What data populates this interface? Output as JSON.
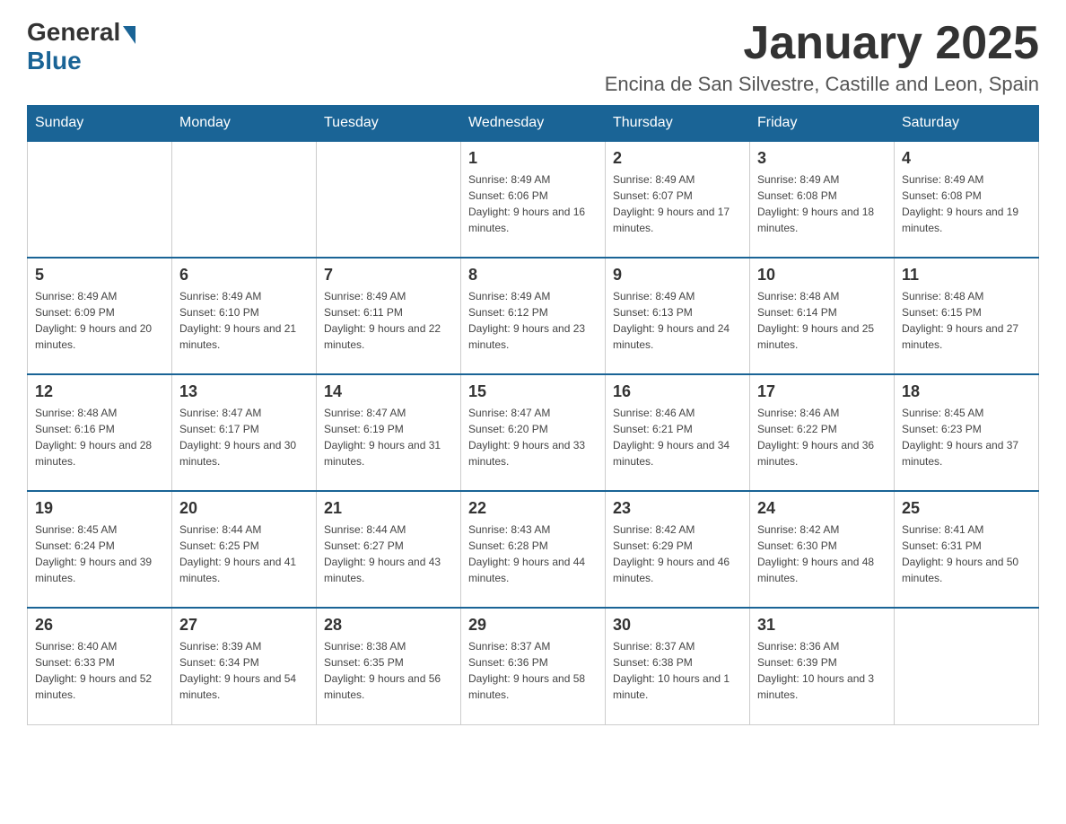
{
  "header": {
    "logo": {
      "general": "General",
      "blue": "Blue"
    },
    "title": "January 2025",
    "location": "Encina de San Silvestre, Castille and Leon, Spain"
  },
  "calendar": {
    "days_of_week": [
      "Sunday",
      "Monday",
      "Tuesday",
      "Wednesday",
      "Thursday",
      "Friday",
      "Saturday"
    ],
    "weeks": [
      [
        {
          "day": "",
          "info": ""
        },
        {
          "day": "",
          "info": ""
        },
        {
          "day": "",
          "info": ""
        },
        {
          "day": "1",
          "info": "Sunrise: 8:49 AM\nSunset: 6:06 PM\nDaylight: 9 hours and 16 minutes."
        },
        {
          "day": "2",
          "info": "Sunrise: 8:49 AM\nSunset: 6:07 PM\nDaylight: 9 hours and 17 minutes."
        },
        {
          "day": "3",
          "info": "Sunrise: 8:49 AM\nSunset: 6:08 PM\nDaylight: 9 hours and 18 minutes."
        },
        {
          "day": "4",
          "info": "Sunrise: 8:49 AM\nSunset: 6:08 PM\nDaylight: 9 hours and 19 minutes."
        }
      ],
      [
        {
          "day": "5",
          "info": "Sunrise: 8:49 AM\nSunset: 6:09 PM\nDaylight: 9 hours and 20 minutes."
        },
        {
          "day": "6",
          "info": "Sunrise: 8:49 AM\nSunset: 6:10 PM\nDaylight: 9 hours and 21 minutes."
        },
        {
          "day": "7",
          "info": "Sunrise: 8:49 AM\nSunset: 6:11 PM\nDaylight: 9 hours and 22 minutes."
        },
        {
          "day": "8",
          "info": "Sunrise: 8:49 AM\nSunset: 6:12 PM\nDaylight: 9 hours and 23 minutes."
        },
        {
          "day": "9",
          "info": "Sunrise: 8:49 AM\nSunset: 6:13 PM\nDaylight: 9 hours and 24 minutes."
        },
        {
          "day": "10",
          "info": "Sunrise: 8:48 AM\nSunset: 6:14 PM\nDaylight: 9 hours and 25 minutes."
        },
        {
          "day": "11",
          "info": "Sunrise: 8:48 AM\nSunset: 6:15 PM\nDaylight: 9 hours and 27 minutes."
        }
      ],
      [
        {
          "day": "12",
          "info": "Sunrise: 8:48 AM\nSunset: 6:16 PM\nDaylight: 9 hours and 28 minutes."
        },
        {
          "day": "13",
          "info": "Sunrise: 8:47 AM\nSunset: 6:17 PM\nDaylight: 9 hours and 30 minutes."
        },
        {
          "day": "14",
          "info": "Sunrise: 8:47 AM\nSunset: 6:19 PM\nDaylight: 9 hours and 31 minutes."
        },
        {
          "day": "15",
          "info": "Sunrise: 8:47 AM\nSunset: 6:20 PM\nDaylight: 9 hours and 33 minutes."
        },
        {
          "day": "16",
          "info": "Sunrise: 8:46 AM\nSunset: 6:21 PM\nDaylight: 9 hours and 34 minutes."
        },
        {
          "day": "17",
          "info": "Sunrise: 8:46 AM\nSunset: 6:22 PM\nDaylight: 9 hours and 36 minutes."
        },
        {
          "day": "18",
          "info": "Sunrise: 8:45 AM\nSunset: 6:23 PM\nDaylight: 9 hours and 37 minutes."
        }
      ],
      [
        {
          "day": "19",
          "info": "Sunrise: 8:45 AM\nSunset: 6:24 PM\nDaylight: 9 hours and 39 minutes."
        },
        {
          "day": "20",
          "info": "Sunrise: 8:44 AM\nSunset: 6:25 PM\nDaylight: 9 hours and 41 minutes."
        },
        {
          "day": "21",
          "info": "Sunrise: 8:44 AM\nSunset: 6:27 PM\nDaylight: 9 hours and 43 minutes."
        },
        {
          "day": "22",
          "info": "Sunrise: 8:43 AM\nSunset: 6:28 PM\nDaylight: 9 hours and 44 minutes."
        },
        {
          "day": "23",
          "info": "Sunrise: 8:42 AM\nSunset: 6:29 PM\nDaylight: 9 hours and 46 minutes."
        },
        {
          "day": "24",
          "info": "Sunrise: 8:42 AM\nSunset: 6:30 PM\nDaylight: 9 hours and 48 minutes."
        },
        {
          "day": "25",
          "info": "Sunrise: 8:41 AM\nSunset: 6:31 PM\nDaylight: 9 hours and 50 minutes."
        }
      ],
      [
        {
          "day": "26",
          "info": "Sunrise: 8:40 AM\nSunset: 6:33 PM\nDaylight: 9 hours and 52 minutes."
        },
        {
          "day": "27",
          "info": "Sunrise: 8:39 AM\nSunset: 6:34 PM\nDaylight: 9 hours and 54 minutes."
        },
        {
          "day": "28",
          "info": "Sunrise: 8:38 AM\nSunset: 6:35 PM\nDaylight: 9 hours and 56 minutes."
        },
        {
          "day": "29",
          "info": "Sunrise: 8:37 AM\nSunset: 6:36 PM\nDaylight: 9 hours and 58 minutes."
        },
        {
          "day": "30",
          "info": "Sunrise: 8:37 AM\nSunset: 6:38 PM\nDaylight: 10 hours and 1 minute."
        },
        {
          "day": "31",
          "info": "Sunrise: 8:36 AM\nSunset: 6:39 PM\nDaylight: 10 hours and 3 minutes."
        },
        {
          "day": "",
          "info": ""
        }
      ]
    ]
  }
}
